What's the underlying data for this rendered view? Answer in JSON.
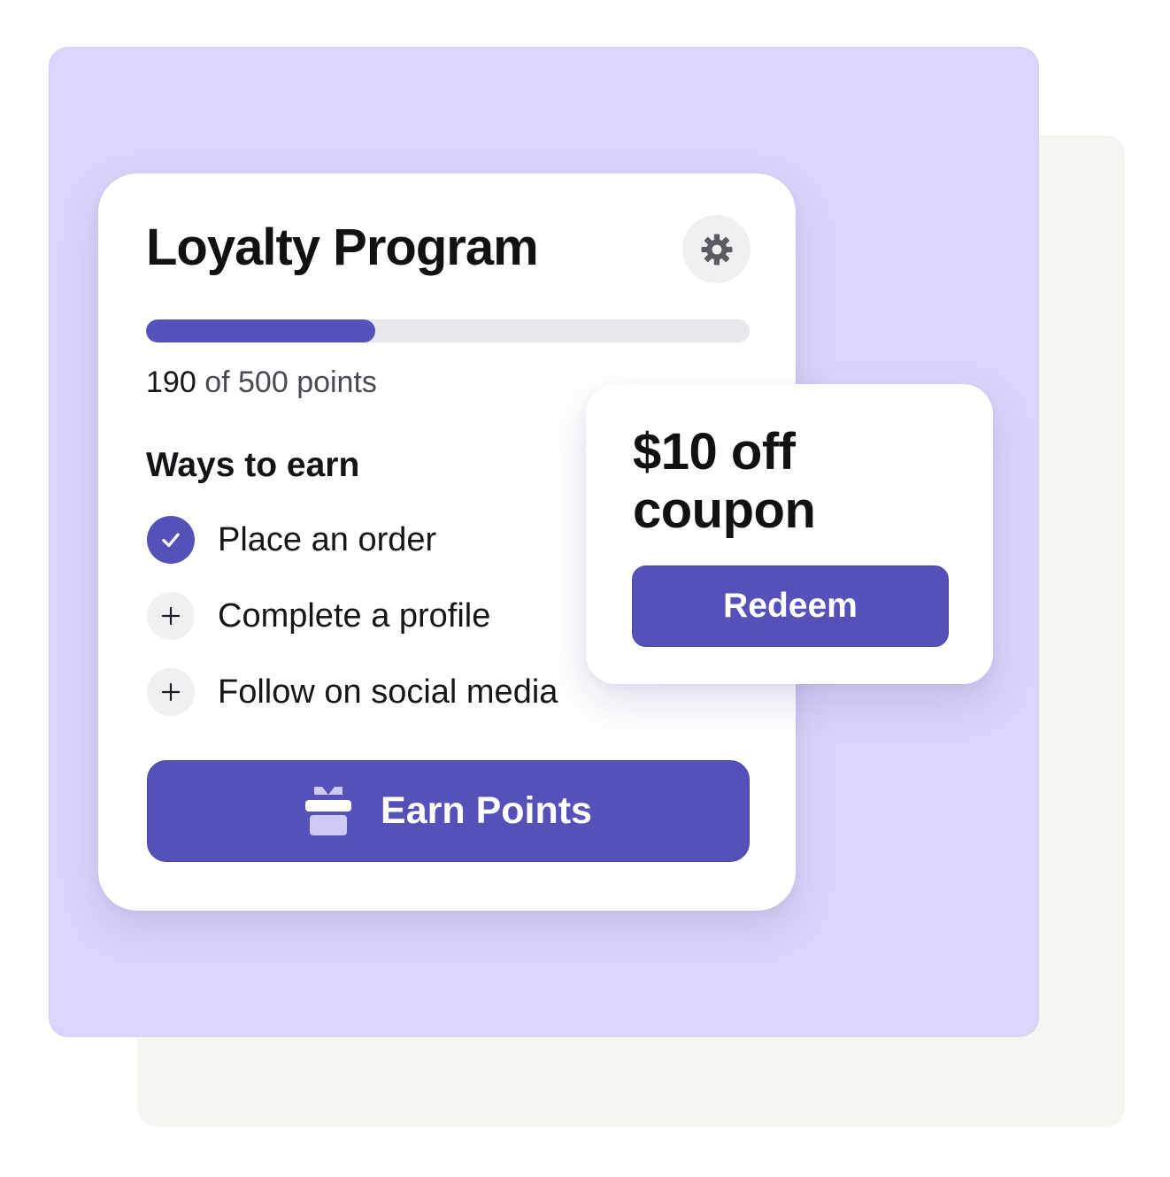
{
  "colors": {
    "accent": "#5650b9",
    "canvas_back": "#f4f6f1",
    "canvas_front": "#dad5fa",
    "card": "#ffffff",
    "track": "#e8e8ec"
  },
  "loyalty": {
    "title": "Loyalty Program",
    "settings_icon": "gear-icon",
    "progress": {
      "current": "190",
      "of_text": "of",
      "total": "500",
      "unit": "points",
      "fraction": 0.38
    },
    "ways_title": "Ways to earn",
    "tasks": [
      {
        "label": "Place an order",
        "completed": true,
        "icon": "check-icon"
      },
      {
        "label": "Complete a profile",
        "completed": false,
        "icon": "plus-icon"
      },
      {
        "label": "Follow on social media",
        "completed": false,
        "icon": "plus-icon"
      }
    ],
    "earn_button": {
      "label": "Earn Points",
      "icon": "gift-icon"
    }
  },
  "coupon": {
    "title": "$10 off coupon",
    "redeem_label": "Redeem"
  }
}
